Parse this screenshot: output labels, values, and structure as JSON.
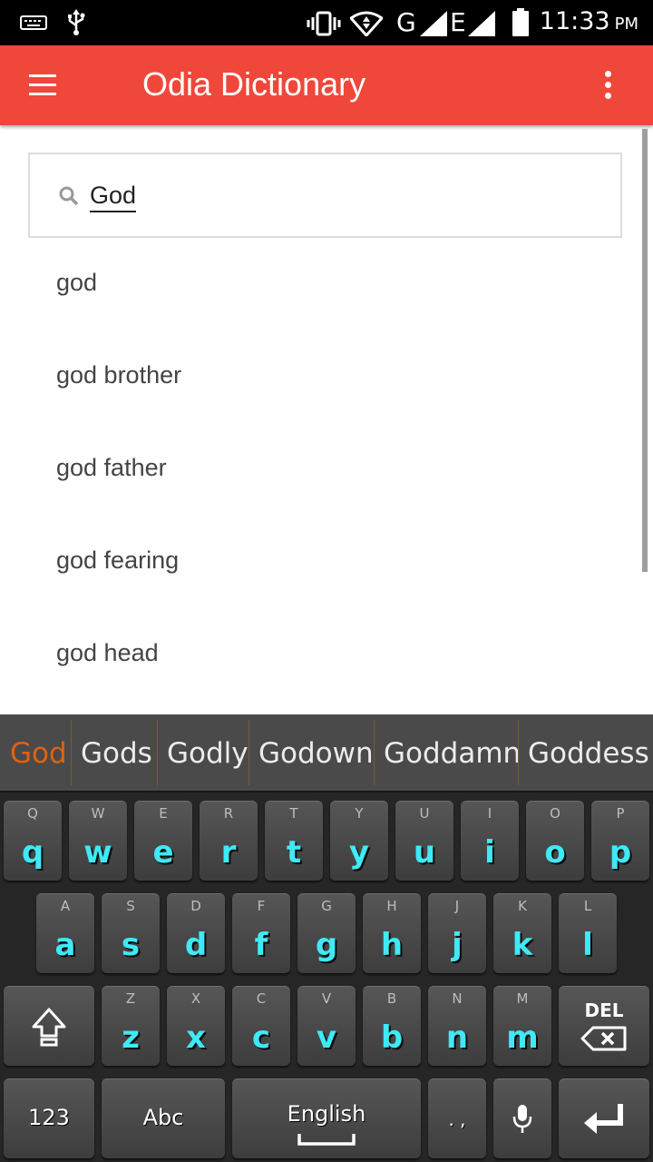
{
  "status_bar": {
    "time": "11:33",
    "ampm": "PM",
    "network_g": "G",
    "network_e": "E"
  },
  "app_bar": {
    "title": "Odia Dictionary",
    "menu_icon": "hamburger-menu-icon",
    "overflow_icon": "more-vert-icon",
    "color": "#f0473b"
  },
  "search": {
    "value": "God",
    "icon": "search-icon"
  },
  "results": [
    {
      "label": "god"
    },
    {
      "label": "god brother"
    },
    {
      "label": "god father"
    },
    {
      "label": "god fearing"
    },
    {
      "label": "god head"
    }
  ],
  "keyboard": {
    "suggestions": [
      "God",
      "Gods",
      "Godly",
      "Godown",
      "Goddamn",
      "Goddess"
    ],
    "row1": [
      {
        "hint": "Q",
        "key": "q"
      },
      {
        "hint": "W",
        "key": "w"
      },
      {
        "hint": "E",
        "key": "e"
      },
      {
        "hint": "R",
        "key": "r"
      },
      {
        "hint": "T",
        "key": "t"
      },
      {
        "hint": "Y",
        "key": "y"
      },
      {
        "hint": "U",
        "key": "u"
      },
      {
        "hint": "I",
        "key": "i"
      },
      {
        "hint": "O",
        "key": "o"
      },
      {
        "hint": "P",
        "key": "p"
      }
    ],
    "row2": [
      {
        "hint": "A",
        "key": "a"
      },
      {
        "hint": "S",
        "key": "s"
      },
      {
        "hint": "D",
        "key": "d"
      },
      {
        "hint": "F",
        "key": "f"
      },
      {
        "hint": "G",
        "key": "g"
      },
      {
        "hint": "H",
        "key": "h"
      },
      {
        "hint": "J",
        "key": "j"
      },
      {
        "hint": "K",
        "key": "k"
      },
      {
        "hint": "L",
        "key": "l"
      }
    ],
    "row3": [
      {
        "hint": "Z",
        "key": "z"
      },
      {
        "hint": "X",
        "key": "x"
      },
      {
        "hint": "C",
        "key": "c"
      },
      {
        "hint": "V",
        "key": "v"
      },
      {
        "hint": "B",
        "key": "b"
      },
      {
        "hint": "N",
        "key": "n"
      },
      {
        "hint": "M",
        "key": "m"
      }
    ],
    "del_label": "DEL",
    "num_label": "123",
    "abc_label": "Abc",
    "space_label": "English",
    "punct_label": ". ,",
    "accent_color": "#3fe9f5",
    "suggestion_color": "#e0620f"
  }
}
